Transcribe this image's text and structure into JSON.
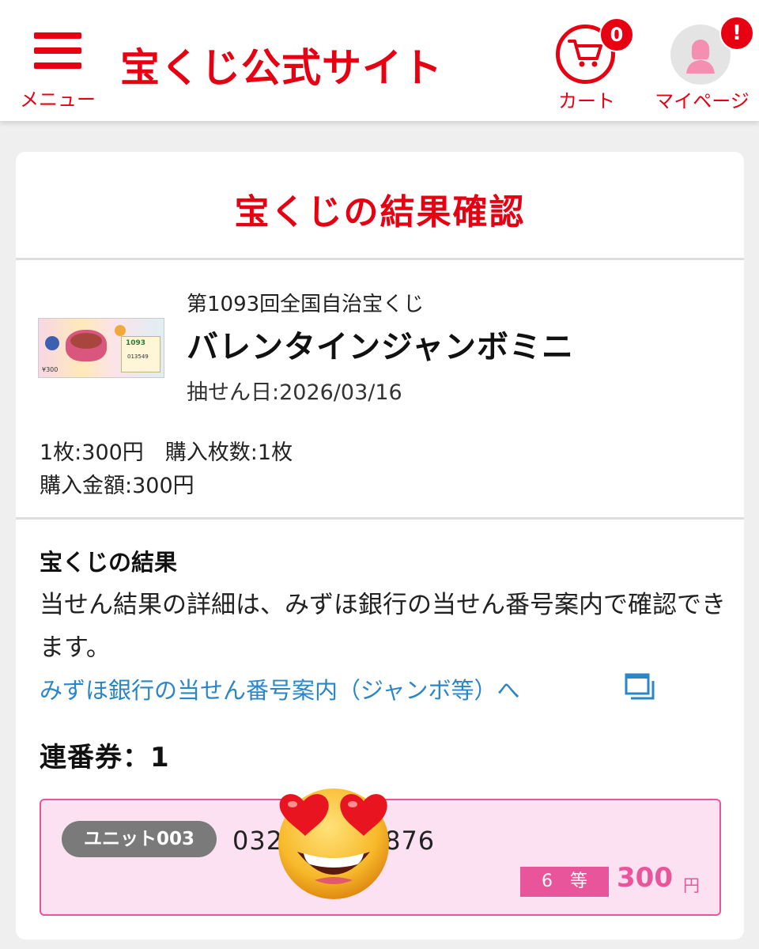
{
  "header": {
    "menu_label": "メニュー",
    "site_title": "宝くじ公式サイト",
    "cart_label": "カート",
    "cart_count": "0",
    "mypage_label": "マイページ",
    "mypage_badge": "!"
  },
  "card": {
    "title": "宝くじの結果確認",
    "lottery": {
      "round": "第1093回全国自治宝くじ",
      "name": "バレンタインジャンボミニ",
      "draw_date": "抽せん日:2026/03/16",
      "price_line": "1枚:300円　購入枚数:1枚",
      "total": "購入金額:300円"
    },
    "result": {
      "heading": "宝くじの結果",
      "text": "当せん結果の詳細は、みずほ銀行の当せん番号案内で確認できます。",
      "link": "みずほ銀行の当せん番号案内（ジャンボ等）へ"
    },
    "serial": {
      "heading": "連番券：1",
      "unit": "ユニット003",
      "number": "032",
      "number_tail": "876",
      "rank": "6　等",
      "amount": "300",
      "unit_yen": "円"
    }
  },
  "colors": {
    "brand_red": "#e60012",
    "pink": "#e8559b",
    "link_blue": "#2a86c6"
  },
  "icons": [
    "menu-icon",
    "cart-icon",
    "user-icon",
    "external-window-icon",
    "heart-eyes-emoji"
  ]
}
